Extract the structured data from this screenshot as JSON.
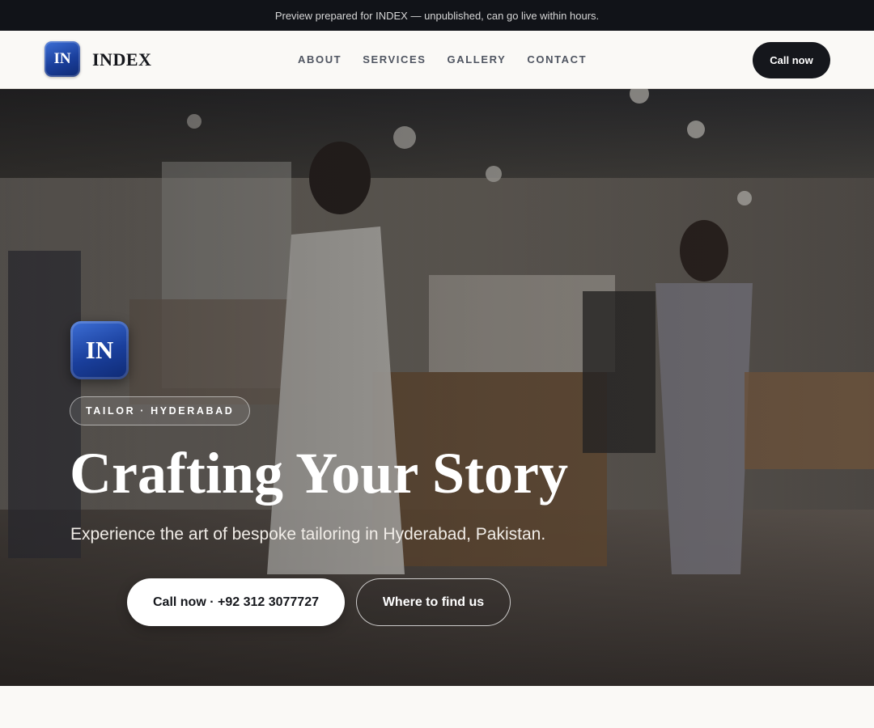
{
  "preview_bar": {
    "text": "Preview prepared for INDEX — unpublished, can go live within hours."
  },
  "header": {
    "logo_initials": "IN",
    "brand": "INDEX",
    "nav": [
      "ABOUT",
      "SERVICES",
      "GALLERY",
      "CONTACT"
    ],
    "call_label": "Call now"
  },
  "hero": {
    "logo_initials": "IN",
    "tag": "TAILOR · HYDERABAD",
    "headline": "Crafting Your Story",
    "subtitle": "Experience the art of bespoke tailoring in Hyderabad, Pakistan.",
    "primary_cta": "Call now · +92 312 3077727",
    "secondary_cta": "Where to find us",
    "background_image": "clothing boutique interior with two women browsing garment racks"
  },
  "colors": {
    "dark": "#111318",
    "accent_blue": "#1a3f9c",
    "page_bg": "#faf9f6"
  }
}
